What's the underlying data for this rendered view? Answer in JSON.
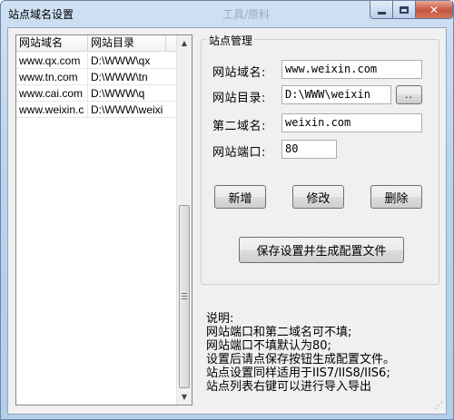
{
  "window": {
    "title": "站点域名设置",
    "ghost_title": "工具/原料",
    "minimize_label": "",
    "maximize_label": "",
    "close_label": "✕"
  },
  "list": {
    "columns": [
      "网站域名",
      "网站目录"
    ],
    "rows": [
      {
        "domain": "www.qx.com",
        "dir": "D:\\WWW\\qx"
      },
      {
        "domain": "www.tn.com",
        "dir": "D:\\WWW\\tn"
      },
      {
        "domain": "www.cai.com",
        "dir": "D:\\WWW\\q"
      },
      {
        "domain": "www.weixin.c",
        "dir": "D:\\WWW\\weixi"
      }
    ],
    "scroll_up": "▲",
    "scroll_down": "▼"
  },
  "site": {
    "group_title": "站点管理",
    "domain_label": "网站域名:",
    "domain_value": "www.weixin.com",
    "dir_label": "网站目录:",
    "dir_value": "D:\\WWW\\weixin",
    "browse_label": "..",
    "second_domain_label": "第二域名:",
    "second_domain_value": "weixin.com",
    "port_label": "网站端口:",
    "port_value": "80",
    "add_label": "新增",
    "edit_label": "修改",
    "delete_label": "删除",
    "save_label": "保存设置并生成配置文件"
  },
  "notes": [
    "说明:",
    "网站端口和第二域名可不填;",
    "网站端口不填默认为80;",
    "设置后请点保存按钮生成配置文件。",
    "站点设置同样适用于IIS7/IIS8/IIS6;",
    "站点列表右键可以进行导入导出"
  ]
}
